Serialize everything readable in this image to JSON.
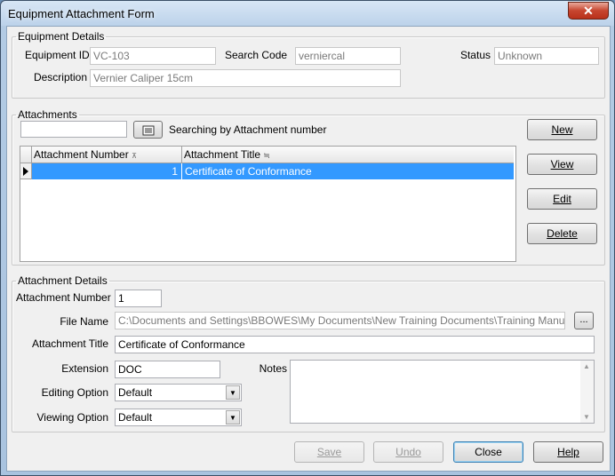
{
  "window": {
    "title": "Equipment Attachment Form",
    "close_glyph": "✕"
  },
  "equipment_details": {
    "legend": "Equipment Details",
    "id_label": "Equipment ID",
    "id_value": "VC-103",
    "search_code_label": "Search Code",
    "search_code_value": "verniercal",
    "status_label": "Status",
    "status_value": "Unknown",
    "description_label": "Description",
    "description_value": "Vernier Caliper 15cm"
  },
  "attachments": {
    "legend": "Attachments",
    "search_value": "",
    "search_mode_text": "Searching by Attachment number",
    "columns": [
      "Attachment Number",
      "Attachment Title"
    ],
    "rows": [
      {
        "number": "1",
        "title": "Certificate of Conformance"
      }
    ],
    "buttons": {
      "new": "New",
      "view": "View",
      "edit": "Edit",
      "delete": "Delete"
    }
  },
  "attachment_details": {
    "legend": "Attachment Details",
    "number_label": "Attachment Number",
    "number_value": "1",
    "file_name_label": "File Name",
    "file_name_value": "C:\\Documents and Settings\\BBOWES\\My Documents\\New Training Documents\\Training Manuals\\Versic",
    "browse_label": "...",
    "title_label": "Attachment Title",
    "title_value": "Certificate of Conformance",
    "extension_label": "Extension",
    "extension_value": "DOC",
    "notes_label": "Notes",
    "notes_value": "",
    "editing_label": "Editing Option",
    "editing_value": "Default",
    "viewing_label": "Viewing Option",
    "viewing_value": "Default"
  },
  "footer": {
    "save": "Save",
    "undo": "Undo",
    "close": "Close",
    "help": "Help"
  },
  "icons": {
    "row_pointer": "row-pointer-icon",
    "sort": "sort-icon",
    "search_mode": "search-mode-icon",
    "dropdown": "chevron-down-icon"
  },
  "colors": {
    "selection": "#3399ff",
    "title_close": "#c7452f"
  }
}
